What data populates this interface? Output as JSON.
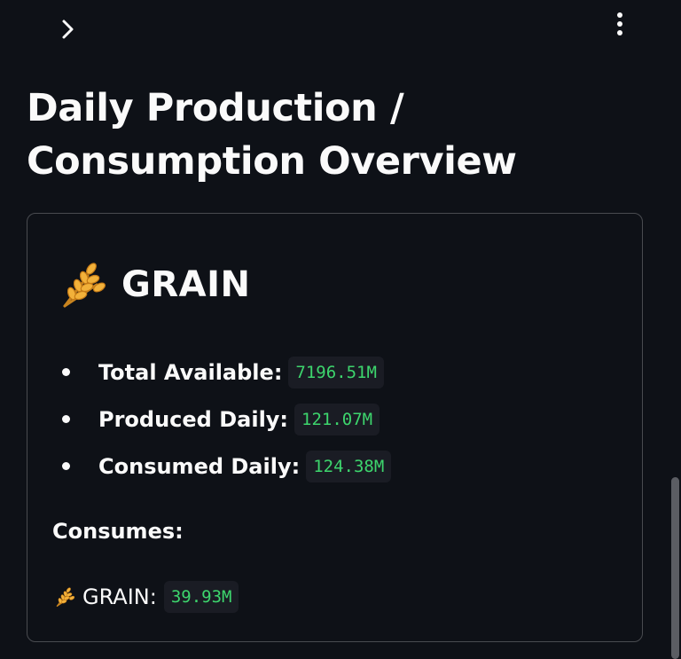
{
  "topbar": {
    "expand_icon": "chevron-right-icon",
    "menu_icon": "vertical-ellipsis-icon"
  },
  "page": {
    "title": "Daily Production / Consumption Overview"
  },
  "resource": {
    "icon": "wheat-sheaf-icon",
    "name": "GRAIN",
    "stats": [
      {
        "label": "Total Available:",
        "value": "7196.51M"
      },
      {
        "label": "Produced Daily:",
        "value": "121.07M"
      },
      {
        "label": "Consumed Daily:",
        "value": "124.38M"
      }
    ],
    "consumes_heading": "Consumes:",
    "consumes": [
      {
        "icon": "wheat-sheaf-icon",
        "label": "GRAIN:",
        "value": "39.93M"
      }
    ]
  },
  "colors": {
    "background": "#0e1117",
    "text": "#fafafa",
    "code_text": "#3dd56d",
    "code_background": "#1a1c24",
    "card_border": "#4a4d55"
  }
}
